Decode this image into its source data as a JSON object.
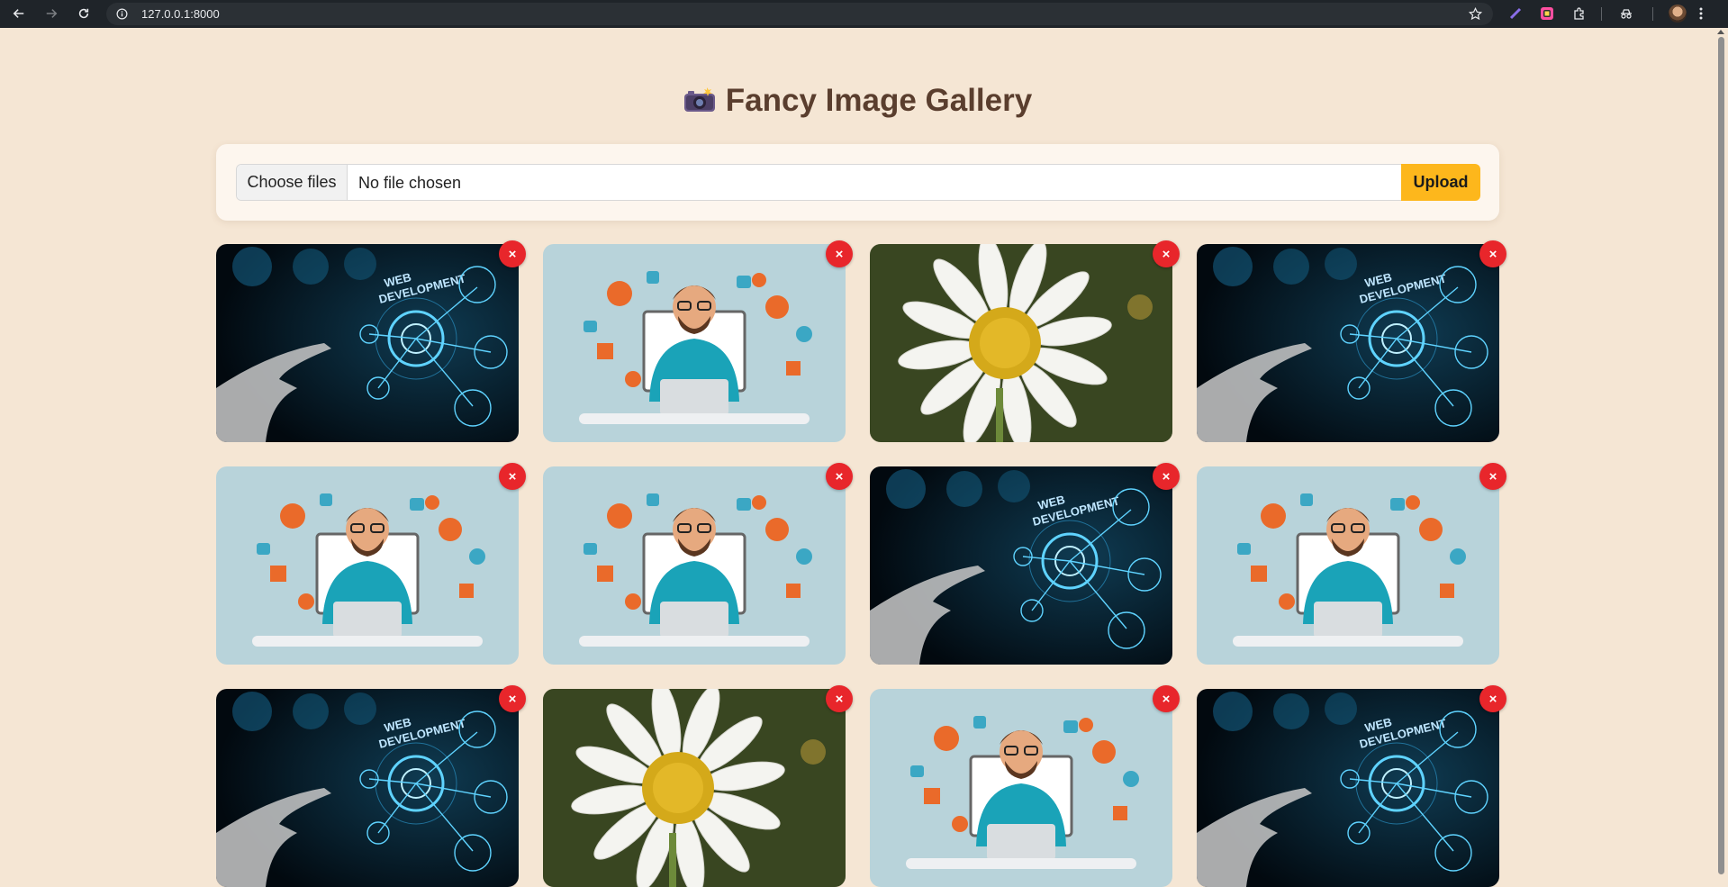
{
  "browser": {
    "url": "127.0.0.1:8000"
  },
  "page": {
    "title": "Fancy Image Gallery",
    "title_icon": "camera-flash-emoji"
  },
  "upload": {
    "choose_label": "Choose files",
    "file_status": "No file chosen",
    "upload_label": "Upload"
  },
  "gallery": {
    "delete_label": "×",
    "images": [
      {
        "kind": "web-development"
      },
      {
        "kind": "developer-illustration"
      },
      {
        "kind": "daisy-flower"
      },
      {
        "kind": "web-development"
      },
      {
        "kind": "developer-illustration"
      },
      {
        "kind": "developer-illustration"
      },
      {
        "kind": "web-development"
      },
      {
        "kind": "developer-illustration"
      },
      {
        "kind": "web-development"
      },
      {
        "kind": "daisy-flower"
      },
      {
        "kind": "developer-illustration"
      },
      {
        "kind": "web-development"
      }
    ]
  },
  "colors": {
    "page_bg": "#f5e6d4",
    "title": "#5a3e2e",
    "upload_button": "#fdb71c",
    "delete_button": "#e8262b"
  }
}
